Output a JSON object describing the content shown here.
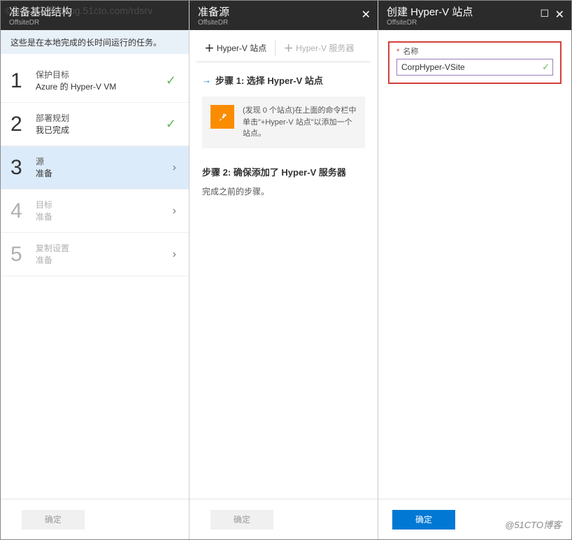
{
  "watermark_top": "© 2018中博//blog.51cto.com/rdsrv",
  "watermark_bottom": "@51CTO博客",
  "col1": {
    "title": "准备基础结构",
    "sub": "OffsiteDR",
    "note": "这些是在本地完成的长时间运行的任务。",
    "steps": [
      {
        "num": "1",
        "lbl1": "保护目标",
        "lbl2": "Azure 的 Hyper-V VM",
        "state": "done"
      },
      {
        "num": "2",
        "lbl1": "部署规划",
        "lbl2": "我已完成",
        "state": "done"
      },
      {
        "num": "3",
        "lbl1": "源",
        "lbl2": "准备",
        "state": "active"
      },
      {
        "num": "4",
        "lbl1": "目标",
        "lbl2": "准备",
        "state": "dim"
      },
      {
        "num": "5",
        "lbl1": "复制设置",
        "lbl2": "准备",
        "state": "dim"
      }
    ],
    "btn": "确定"
  },
  "col2": {
    "title": "准备源",
    "sub": "OffsiteDR",
    "tabs": {
      "t1": "Hyper-V 站点",
      "t2": "Hyper-V 服务器"
    },
    "step1_title": "步骤 1: 选择 Hyper-V 站点",
    "info_text": "(发现 0 个站点)在上面的命令栏中单击\"+Hyper-V 站点\"以添加一个站点。",
    "step2_title": "步骤 2: 确保添加了 Hyper-V 服务器",
    "step2_body": "完成之前的步骤。",
    "btn": "确定"
  },
  "col3": {
    "title": "创建 Hyper-V 站点",
    "sub": "OffsiteDR",
    "field_label": "名称",
    "field_value": "CorpHyper-VSite",
    "btn": "确定"
  }
}
